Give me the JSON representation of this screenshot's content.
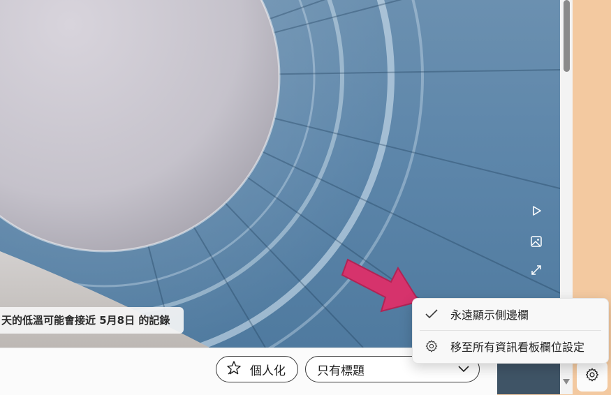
{
  "hero": {
    "caption": "天的低溫可能會接近 5月8日 的記錄",
    "side_actions": [
      {
        "icon": "play-icon"
      },
      {
        "icon": "image-icon"
      },
      {
        "icon": "expand-icon"
      }
    ]
  },
  "toolbar": {
    "personalize_label": "個人化",
    "view_select_value": "只有標題"
  },
  "context_menu": {
    "items": [
      {
        "label": "永遠顯示側邊欄",
        "icon": "checkmark-icon",
        "checked": true
      },
      {
        "label": "移至所有資訊看板欄位設定",
        "icon": "gear-icon",
        "checked": false
      }
    ]
  },
  "colors": {
    "page_background": "#f3c9a0",
    "arrow_pink": "#d6336c"
  }
}
